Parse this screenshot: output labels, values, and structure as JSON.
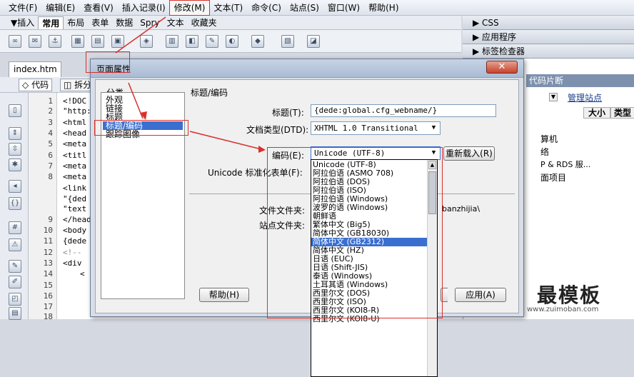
{
  "menu": [
    "文件(F)",
    "编辑(E)",
    "查看(V)",
    "插入记录(I)",
    "修改(M)",
    "文本(T)",
    "命令(C)",
    "站点(S)",
    "窗口(W)",
    "帮助(H)"
  ],
  "insert_bar": {
    "tabs": [
      "▼插入",
      "常用",
      "布局",
      "表单",
      "数据",
      "Spry",
      "文本",
      "收藏夹"
    ]
  },
  "panels": {
    "css": "▶ CSS",
    "app": "▶ 应用程序",
    "tag_inspector": "▶ 标签检查器",
    "snippets": "代码片断",
    "manage_site": "管理站点",
    "col_size": "大小",
    "col_type": "类型",
    "tree_items": [
      "算机",
      "络",
      "P & RDS 服...",
      "面项目"
    ]
  },
  "doc": {
    "tab": "index.htm",
    "code_btn": "代码",
    "split_btn": "拆分",
    "lines": [
      "1",
      "2",
      "3",
      "4",
      "5",
      "6",
      "7",
      "8",
      "",
      "",
      "9",
      "10",
      "11",
      "12",
      "13",
      "14",
      "15",
      "16",
      "17",
      "18"
    ],
    "code": [
      "<!DOC",
      "\"http:",
      "<html",
      "<head",
      "<meta",
      "<titl",
      "<meta",
      "<meta",
      "<link",
      "\"{ded",
      "\"text",
      "</head",
      "<body",
      "{dede",
      "<!--",
      "<div",
      "<",
      "",
      "",
      ""
    ]
  },
  "dialog": {
    "title": "页面属性",
    "close": "✕",
    "category_label": "分类",
    "categories": [
      "外观",
      "链接",
      "标题",
      "标题/编码",
      "跟踪图像"
    ],
    "section": "标题/编码",
    "title_label": "标题(T):",
    "title_value": "{dede:global.cfg_webname/}",
    "doctype_label": "文档类型(DTD):",
    "doctype_value": "XHTML 1.0 Transitional",
    "encoding_label": "编码(E):",
    "encoding_value": "Unicode (UTF-8)",
    "reload_btn": "重新载入(R)",
    "normalize_label": "Unicode 标准化表单(F):",
    "doc_folder_label": "文件文件夹:",
    "doc_folder_value": "banzhijia\\",
    "site_folder_label": "站点文件夹:",
    "help_btn": "帮助(H)",
    "apply_btn": "应用(A)"
  },
  "encoding_options": [
    "Unicode (UTF-8)",
    "阿拉伯语 (ASMO 708)",
    "阿拉伯语 (DOS)",
    "阿拉伯语 (ISO)",
    "阿拉伯语 (Windows)",
    "波罗的语 (Windows)",
    "朝鲜语",
    "繁体中文 (Big5)",
    "简体中文 (GB18030)",
    "简体中文 (GB2312)",
    "简体中文 (HZ)",
    "日语 (EUC)",
    "日语 (Shift-JIS)",
    "泰语 (Windows)",
    "土耳其语 (Windows)",
    "西里尔文 (DOS)",
    "西里尔文 (ISO)",
    "西里尔文 (KOI8-R)",
    "西里尔文 (KOI8-U)"
  ],
  "selected_option": "简体中文 (GB2312)",
  "watermark": {
    "text": "最模板",
    "url": "www.zuimoban.com"
  }
}
